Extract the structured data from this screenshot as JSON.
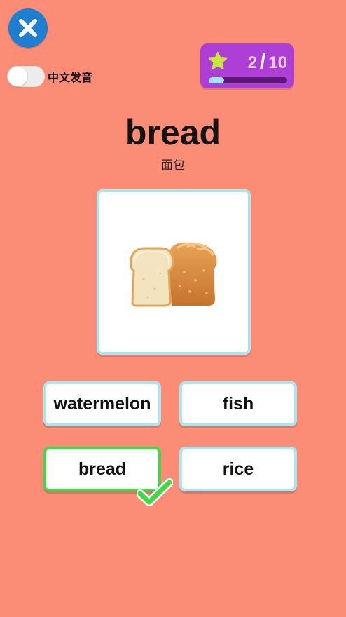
{
  "header": {
    "close_icon": "close-icon",
    "toggle_label": "中文发音",
    "toggle_on": false
  },
  "progress": {
    "current": "2",
    "separator": "/",
    "total": "10",
    "fraction": 0.2,
    "star_color": "#c7e838",
    "box_color": "#ae3fd6",
    "fill_color": "#9fe4f2"
  },
  "question": {
    "word": "bread",
    "translation": "面包",
    "image_icon": "bread-loaf-icon"
  },
  "options": [
    {
      "label": "watermelon",
      "state": "normal"
    },
    {
      "label": "fish",
      "state": "normal"
    },
    {
      "label": "bread",
      "state": "correct"
    },
    {
      "label": "rice",
      "state": "normal"
    }
  ],
  "colors": {
    "background": "#fb8c76",
    "card_border": "#a8e6f3",
    "correct_border": "#3fd947",
    "close_button": "#1e7fd0"
  }
}
